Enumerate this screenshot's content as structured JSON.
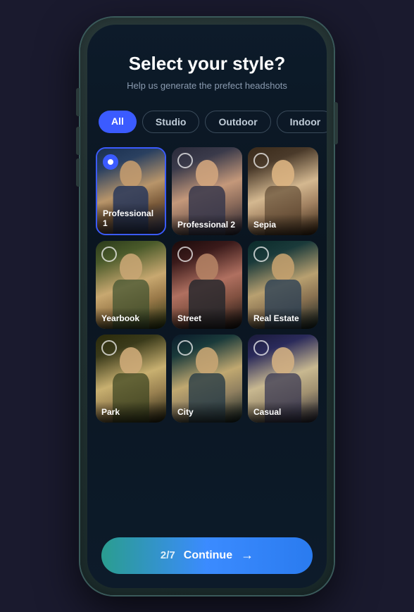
{
  "page": {
    "title": "Select your style?",
    "subtitle": "Help us generate the prefect headshots"
  },
  "filters": {
    "tabs": [
      {
        "id": "all",
        "label": "All",
        "active": true
      },
      {
        "id": "studio",
        "label": "Studio",
        "active": false
      },
      {
        "id": "outdoor",
        "label": "Outdoor",
        "active": false
      },
      {
        "id": "indoor",
        "label": "Indoor",
        "active": false
      }
    ]
  },
  "styles": [
    {
      "id": 1,
      "label": "Professional 1",
      "selected": true,
      "colorClass": "p1"
    },
    {
      "id": 2,
      "label": "Professional 2",
      "selected": false,
      "colorClass": "p2"
    },
    {
      "id": 3,
      "label": "Sepia",
      "selected": false,
      "colorClass": "p3"
    },
    {
      "id": 4,
      "label": "Yearbook",
      "selected": false,
      "colorClass": "p4"
    },
    {
      "id": 5,
      "label": "Street",
      "selected": false,
      "colorClass": "p5"
    },
    {
      "id": 6,
      "label": "Real Estate",
      "selected": false,
      "colorClass": "p6"
    },
    {
      "id": 7,
      "label": "Park",
      "selected": false,
      "colorClass": "p7"
    },
    {
      "id": 8,
      "label": "City",
      "selected": false,
      "colorClass": "p8"
    },
    {
      "id": 9,
      "label": "Casual",
      "selected": false,
      "colorClass": "p9"
    }
  ],
  "bottom_bar": {
    "counter": "2/7",
    "label": "Continue",
    "arrow": "→"
  },
  "colors": {
    "active_tab": "#3b5bff",
    "selected_border": "#3b5bff",
    "bg_dark": "#0d1b2a"
  }
}
